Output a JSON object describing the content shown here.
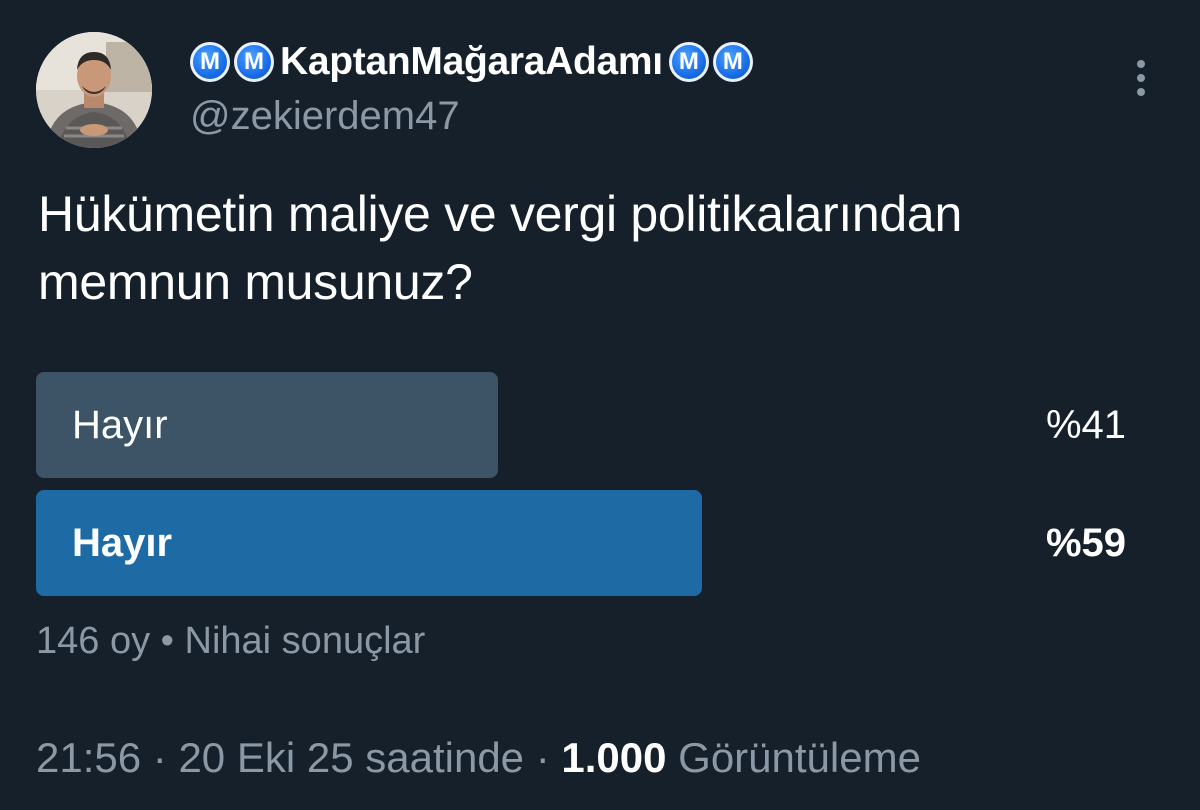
{
  "author": {
    "display_name": "KaptanMağaraAdamı",
    "badge_letter": "M",
    "handle": "@zekierdem47"
  },
  "tweet": {
    "text": "Hükümetin maliye ve vergi politikalarından memnun musunuz?"
  },
  "poll": {
    "options": [
      {
        "label": "Hayır",
        "percent_text": "%41",
        "percent": 41,
        "winner": false
      },
      {
        "label": "Hayır",
        "percent_text": "%59",
        "percent": 59,
        "winner": true
      }
    ],
    "votes": "146 oy",
    "separator": "•",
    "status": "Nihai sonuçlar"
  },
  "footer": {
    "time": "21:56",
    "separator": "·",
    "date": "20 Eki 25 saatinde",
    "views_count": "1.000",
    "views_label": "Görüntüleme"
  },
  "icons": {
    "more": "more-vertical-icon"
  },
  "colors": {
    "background": "#15202b",
    "secondary_text": "#8b98a5",
    "winner_bar": "#1d6aa5",
    "loser_bar": "#3d5466",
    "badge": "#1a6ee8"
  }
}
